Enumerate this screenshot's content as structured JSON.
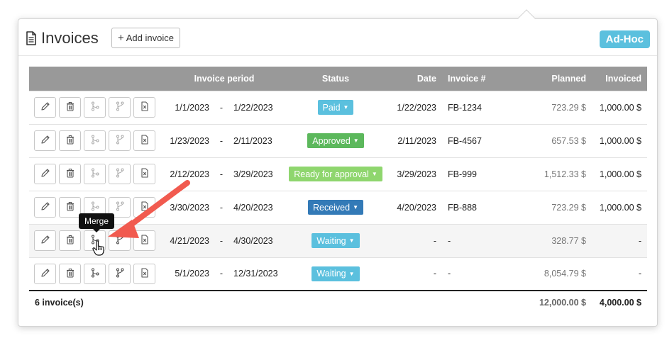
{
  "header": {
    "title": "Invoices",
    "add_label": "Add invoice",
    "add_plus": "+",
    "tag": "Ad-Hoc",
    "tag_color": "#5bc0de"
  },
  "table": {
    "columns": {
      "actions": "",
      "period": "Invoice period",
      "status": "Status",
      "date": "Date",
      "invoice_no": "Invoice #",
      "planned": "Planned",
      "invoiced": "Invoiced"
    },
    "rows": [
      {
        "from": "1/1/2023",
        "sep": "-",
        "to": "1/22/2023",
        "status": "Paid",
        "status_color": "#5bc0de",
        "date": "1/22/2023",
        "invoice_no": "FB-1234",
        "planned": "723.29 $",
        "invoiced": "1,000.00 $"
      },
      {
        "from": "1/23/2023",
        "sep": "-",
        "to": "2/11/2023",
        "status": "Approved",
        "status_color": "#5cb85c",
        "date": "2/11/2023",
        "invoice_no": "FB-4567",
        "planned": "657.53 $",
        "invoiced": "1,000.00 $"
      },
      {
        "from": "2/12/2023",
        "sep": "-",
        "to": "3/29/2023",
        "status": "Ready for approval",
        "status_color": "#8fd66e",
        "date": "3/29/2023",
        "invoice_no": "FB-999",
        "planned": "1,512.33 $",
        "invoiced": "1,000.00 $"
      },
      {
        "from": "3/30/2023",
        "sep": "-",
        "to": "4/20/2023",
        "status": "Received",
        "status_color": "#337ab7",
        "date": "4/20/2023",
        "invoice_no": "FB-888",
        "planned": "723.29 $",
        "invoiced": "1,000.00 $"
      },
      {
        "from": "4/21/2023",
        "sep": "-",
        "to": "4/30/2023",
        "status": "Waiting",
        "status_color": "#5bc0de",
        "date": "-",
        "invoice_no": "-",
        "planned": "328.77 $",
        "invoiced": "-"
      },
      {
        "from": "5/1/2023",
        "sep": "-",
        "to": "12/31/2023",
        "status": "Waiting",
        "status_color": "#5bc0de",
        "date": "-",
        "invoice_no": "-",
        "planned": "8,054.79 $",
        "invoiced": "-"
      }
    ],
    "footer": {
      "count": "6 invoice(s)",
      "planned_total": "12,000.00 $",
      "invoiced_total": "4,000.00 $"
    }
  },
  "tooltip": "Merge",
  "icons": [
    "file-text-icon",
    "edit-icon",
    "trash-icon",
    "merge-up-icon",
    "merge-down-icon",
    "delete-file-icon",
    "caret-down-icon",
    "hand-cursor-icon"
  ],
  "colors": {
    "header_bg": "#999999",
    "annotation_arrow": "#f15a4f"
  }
}
